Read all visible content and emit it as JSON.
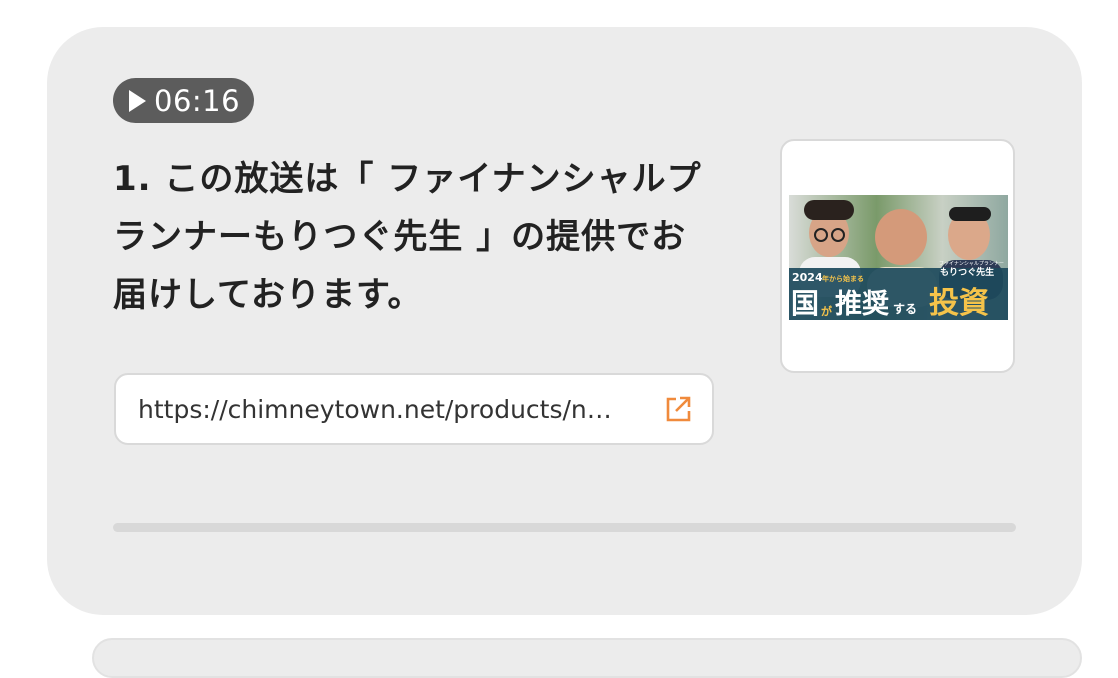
{
  "episode": {
    "timestamp": "06:16",
    "title": "1. この放送は「 ファイナンシャルプランナーもりつぐ先生 」の提供でお届けしております。",
    "link": {
      "url": "https://chimneytown.net/products/n…"
    },
    "thumbnail": {
      "year_text": "2024",
      "year_suffix": "年から始まる",
      "tagline": "ファイナンシャルプランナー",
      "name": "もりつぐ先生",
      "headline_1": "国",
      "headline_2": "が",
      "headline_3": "推奨",
      "headline_4": "する",
      "headline_5": "投資"
    }
  },
  "colors": {
    "card_bg": "#ececec",
    "badge_bg": "#5c5c5c",
    "link_icon": "#f08a3c",
    "headline_accent": "#f5c34a"
  },
  "icons": {
    "play": "play-icon",
    "external": "external-link-icon"
  }
}
